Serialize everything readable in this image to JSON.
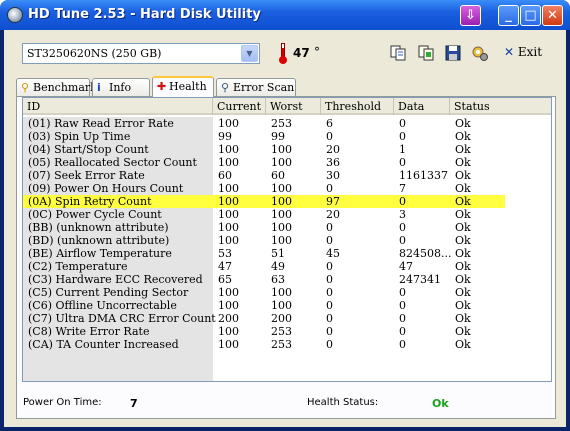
{
  "window": {
    "title": "HD Tune 2.53 - Hard Disk Utility",
    "icons": [
      "download-icon",
      "minimize-icon",
      "maximize-icon",
      "close-icon"
    ]
  },
  "toolbar": {
    "drive": "ST3250620NS (250 GB)",
    "temperature": "47",
    "temperature_unit": "°",
    "exit_label": "Exit"
  },
  "tabs": [
    {
      "label": "Benchmark",
      "icon": "benchmark-icon"
    },
    {
      "label": "Info",
      "icon": "info-icon"
    },
    {
      "label": "Health",
      "icon": "health-icon",
      "active": true
    },
    {
      "label": "Error Scan",
      "icon": "error-scan-icon"
    }
  ],
  "table": {
    "columns": [
      "ID",
      "Current",
      "Worst",
      "Threshold",
      "Data",
      "Status"
    ],
    "rows": [
      [
        "(01) Raw Read Error Rate",
        "100",
        "253",
        "6",
        "0",
        "Ok"
      ],
      [
        "(03) Spin Up Time",
        "99",
        "99",
        "0",
        "0",
        "Ok"
      ],
      [
        "(04) Start/Stop Count",
        "100",
        "100",
        "20",
        "1",
        "Ok"
      ],
      [
        "(05) Reallocated Sector Count",
        "100",
        "100",
        "36",
        "0",
        "Ok"
      ],
      [
        "(07) Seek Error Rate",
        "60",
        "60",
        "30",
        "1161337",
        "Ok"
      ],
      [
        "(09) Power On Hours Count",
        "100",
        "100",
        "0",
        "7",
        "Ok"
      ],
      [
        "(0A) Spin Retry Count",
        "100",
        "100",
        "97",
        "0",
        "Ok"
      ],
      [
        "(0C) Power Cycle Count",
        "100",
        "100",
        "20",
        "3",
        "Ok"
      ],
      [
        "(BB) (unknown attribute)",
        "100",
        "100",
        "0",
        "0",
        "Ok"
      ],
      [
        "(BD) (unknown attribute)",
        "100",
        "100",
        "0",
        "0",
        "Ok"
      ],
      [
        "(BE) Airflow Temperature",
        "53",
        "51",
        "45",
        "824508...",
        "Ok"
      ],
      [
        "(C2) Temperature",
        "47",
        "49",
        "0",
        "47",
        "Ok"
      ],
      [
        "(C3) Hardware ECC Recovered",
        "65",
        "63",
        "0",
        "247341",
        "Ok"
      ],
      [
        "(C5) Current Pending Sector",
        "100",
        "100",
        "0",
        "0",
        "Ok"
      ],
      [
        "(C6) Offline Uncorrectable",
        "100",
        "100",
        "0",
        "0",
        "Ok"
      ],
      [
        "(C7) Ultra DMA CRC Error Count",
        "200",
        "200",
        "0",
        "0",
        "Ok"
      ],
      [
        "(C8) Write Error Rate",
        "100",
        "253",
        "0",
        "0",
        "Ok"
      ],
      [
        "(CA) TA Counter Increased",
        "100",
        "253",
        "0",
        "0",
        "Ok"
      ]
    ],
    "highlight_row_index": 6,
    "highlight_color": "#ffff40"
  },
  "status": {
    "power_on_label": "Power On Time:",
    "power_on_value": "7",
    "health_label": "Health Status:",
    "health_value": "Ok",
    "health_color": "#1aa01a"
  }
}
